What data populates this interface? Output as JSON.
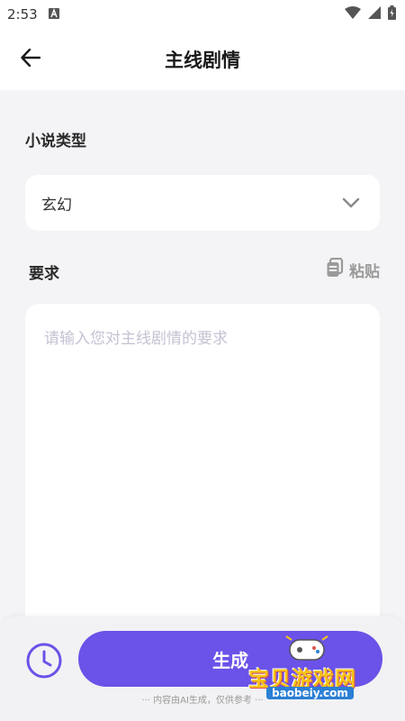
{
  "status_bar": {
    "time": "2:53",
    "notification_icon": "a-letter-icon",
    "icons": [
      "wifi-icon",
      "signal-icon",
      "battery-icon"
    ]
  },
  "header": {
    "title": "主线剧情",
    "back_icon": "arrow-left-icon"
  },
  "form": {
    "genre_label": "小说类型",
    "genre_value": "玄幻",
    "requirement_label": "要求",
    "paste_label": "粘贴",
    "requirement_placeholder": "请输入您对主线剧情的要求",
    "requirement_value": ""
  },
  "footer": {
    "generate_label": "生成",
    "disclaimer": "··· 内容由AI生成，仅供参考 ···",
    "history_icon": "clock-icon"
  },
  "watermark": {
    "text": "宝贝游戏网",
    "url": "baobeiy.com"
  },
  "colors": {
    "accent": "#6b52e8",
    "background": "#f4f4f6",
    "card": "#ffffff",
    "placeholder": "#c4c2d2"
  }
}
